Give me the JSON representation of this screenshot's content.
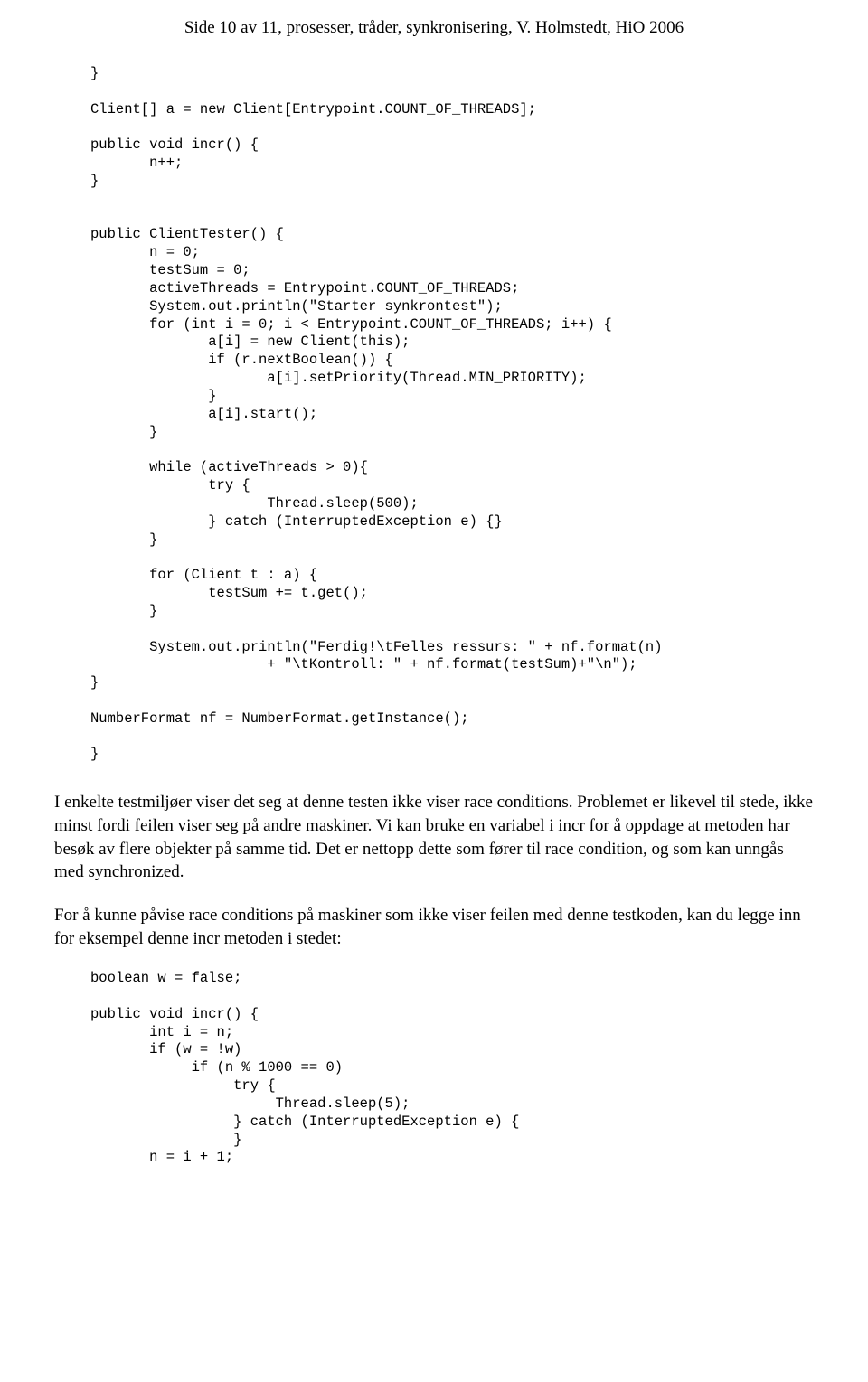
{
  "header": {
    "text": "Side 10 av 11, prosesser, tråder, synkronisering, V. Holmstedt, HiO 2006"
  },
  "code1": {
    "content": "}\n\nClient[] a = new Client[Entrypoint.COUNT_OF_THREADS];\n\npublic void incr() {\n       n++;\n}\n\n\npublic ClientTester() {\n       n = 0;\n       testSum = 0;\n       activeThreads = Entrypoint.COUNT_OF_THREADS;\n       System.out.println(\"Starter synkrontest\");\n       for (int i = 0; i < Entrypoint.COUNT_OF_THREADS; i++) {\n              a[i] = new Client(this);\n              if (r.nextBoolean()) {\n                     a[i].setPriority(Thread.MIN_PRIORITY);\n              }\n              a[i].start();\n       }\n\n       while (activeThreads > 0){\n              try {\n                     Thread.sleep(500);\n              } catch (InterruptedException e) {}\n       }\n\n       for (Client t : a) {\n              testSum += t.get();\n       }\n\n       System.out.println(\"Ferdig!\\tFelles ressurs: \" + nf.format(n)\n                     + \"\\tKontroll: \" + nf.format(testSum)+\"\\n\");\n}\n\nNumberFormat nf = NumberFormat.getInstance();\n\n}"
  },
  "paragraph1": {
    "text": "I enkelte testmiljøer viser det seg at denne testen ikke viser race conditions. Problemet er likevel til stede, ikke minst fordi feilen viser seg på andre maskiner. Vi kan bruke en variabel i incr for å oppdage at metoden har besøk av flere objekter på samme tid. Det er nettopp dette som fører til race condition, og som kan unngås med synchronized."
  },
  "paragraph2": {
    "text": "For å kunne påvise race conditions på maskiner som ikke viser feilen med denne testkoden, kan du legge inn for eksempel denne incr metoden i stedet:"
  },
  "code2": {
    "content": "boolean w = false;\n\npublic void incr() {\n       int i = n;\n       if (w = !w)\n            if (n % 1000 == 0)\n                 try {\n                      Thread.sleep(5);\n                 } catch (InterruptedException e) {\n                 }\n       n = i + 1;"
  }
}
